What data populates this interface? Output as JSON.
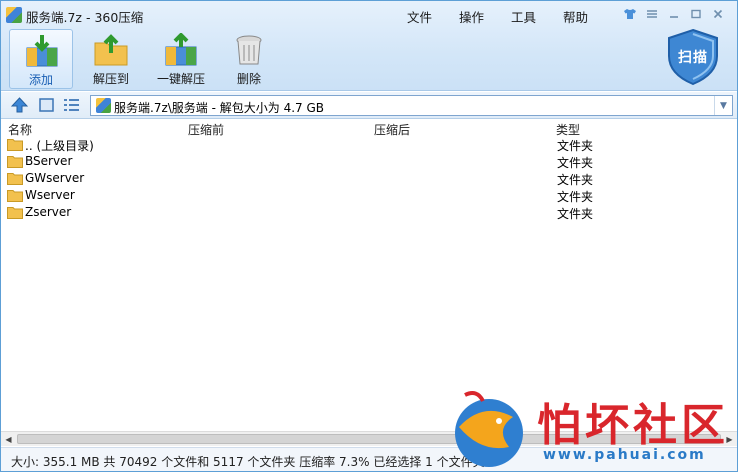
{
  "window": {
    "title": "服务端.7z - 360压缩"
  },
  "menu": [
    "文件",
    "操作",
    "工具",
    "帮助"
  ],
  "toolbar": {
    "add": "添加",
    "extract_to": "解压到",
    "one_click_extract": "一键解压",
    "delete": "删除",
    "scan": "扫描"
  },
  "address": {
    "path": "服务端.7z\\服务端 - 解包大小为 4.7 GB"
  },
  "columns": {
    "name": "名称",
    "before": "压缩前",
    "after": "压缩后",
    "type": "类型"
  },
  "rows": [
    {
      "name": ".. (上级目录)",
      "type": "文件夹"
    },
    {
      "name": "BServer",
      "type": "文件夹"
    },
    {
      "name": "GWserver",
      "type": "文件夹"
    },
    {
      "name": "Wserver",
      "type": "文件夹"
    },
    {
      "name": "Zserver",
      "type": "文件夹"
    }
  ],
  "status": {
    "text": "大小: 355.1 MB 共 70492 个文件和 5117 个文件夹 压缩率 7.3% 已经选择 1 个文件夹"
  },
  "watermark": {
    "brand": "怕坏社区",
    "url": "www.pahuai.com"
  },
  "colors": {
    "accent": "#1a5fb4",
    "folder": "#f2c14e",
    "watermark_red": "#d9262c",
    "watermark_blue": "#2a7ac7"
  }
}
